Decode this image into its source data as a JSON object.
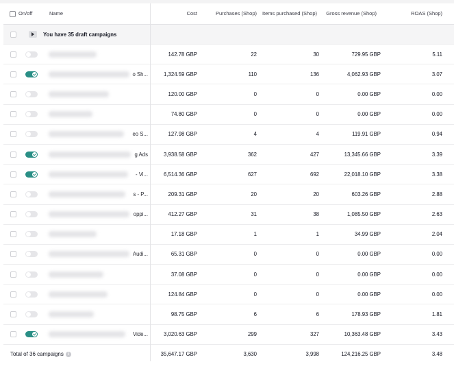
{
  "header": {
    "onoff": "On/off",
    "name": "Name",
    "cost": "Cost",
    "purchases": "Purchases (Shop)",
    "items": "Items purchased (Shop)",
    "gross": "Gross revenue (Shop)",
    "roas": "ROAS (Shop)"
  },
  "draft": {
    "text": "You have 35 draft campaigns"
  },
  "rows": [
    {
      "on": false,
      "tail": "",
      "cost": "142.78 GBP",
      "purchases": "22",
      "items": "30",
      "gross": "729.95 GBP",
      "roas": "5.11"
    },
    {
      "on": true,
      "tail": "o Sh...",
      "cost": "1,324.59 GBP",
      "purchases": "110",
      "items": "136",
      "gross": "4,062.93 GBP",
      "roas": "3.07"
    },
    {
      "on": false,
      "tail": "",
      "cost": "120.00 GBP",
      "purchases": "0",
      "items": "0",
      "gross": "0.00 GBP",
      "roas": "0.00"
    },
    {
      "on": false,
      "tail": "",
      "cost": "74.80 GBP",
      "purchases": "0",
      "items": "0",
      "gross": "0.00 GBP",
      "roas": "0.00"
    },
    {
      "on": false,
      "tail": "eo S...",
      "cost": "127.98 GBP",
      "purchases": "4",
      "items": "4",
      "gross": "119.91 GBP",
      "roas": "0.94"
    },
    {
      "on": true,
      "tail": "g Ads",
      "cost": "3,938.58 GBP",
      "purchases": "362",
      "items": "427",
      "gross": "13,345.66 GBP",
      "roas": "3.39"
    },
    {
      "on": true,
      "tail": "- Vi...",
      "cost": "6,514.36 GBP",
      "purchases": "627",
      "items": "692",
      "gross": "22,018.10 GBP",
      "roas": "3.38"
    },
    {
      "on": false,
      "tail": "s - P...",
      "cost": "209.31 GBP",
      "purchases": "20",
      "items": "20",
      "gross": "603.26 GBP",
      "roas": "2.88"
    },
    {
      "on": false,
      "tail": "oppi...",
      "cost": "412.27 GBP",
      "purchases": "31",
      "items": "38",
      "gross": "1,085.50 GBP",
      "roas": "2.63"
    },
    {
      "on": false,
      "tail": "",
      "cost": "17.18 GBP",
      "purchases": "1",
      "items": "1",
      "gross": "34.99 GBP",
      "roas": "2.04"
    },
    {
      "on": false,
      "tail": "Audi...",
      "cost": "65.31 GBP",
      "purchases": "0",
      "items": "0",
      "gross": "0.00 GBP",
      "roas": "0.00"
    },
    {
      "on": false,
      "tail": "",
      "cost": "37.08 GBP",
      "purchases": "0",
      "items": "0",
      "gross": "0.00 GBP",
      "roas": "0.00"
    },
    {
      "on": false,
      "tail": "",
      "cost": "124.84 GBP",
      "purchases": "0",
      "items": "0",
      "gross": "0.00 GBP",
      "roas": "0.00"
    },
    {
      "on": false,
      "tail": "",
      "cost": "98.75 GBP",
      "purchases": "6",
      "items": "6",
      "gross": "178.93 GBP",
      "roas": "1.81"
    },
    {
      "on": true,
      "tail": "Vide...",
      "cost": "3,020.63 GBP",
      "purchases": "299",
      "items": "327",
      "gross": "10,363.48 GBP",
      "roas": "3.43"
    }
  ],
  "total": {
    "label": "Total of 36 campaigns",
    "info_icon": "info-icon",
    "cost": "35,647.17 GBP",
    "purchases": "3,630",
    "items": "3,998",
    "gross": "124,216.25 GBP",
    "roas": "3.48"
  },
  "colors": {
    "toggle_on": "#2a8f86",
    "toggle_off": "#e6e6e9",
    "row_border": "#ececee"
  }
}
